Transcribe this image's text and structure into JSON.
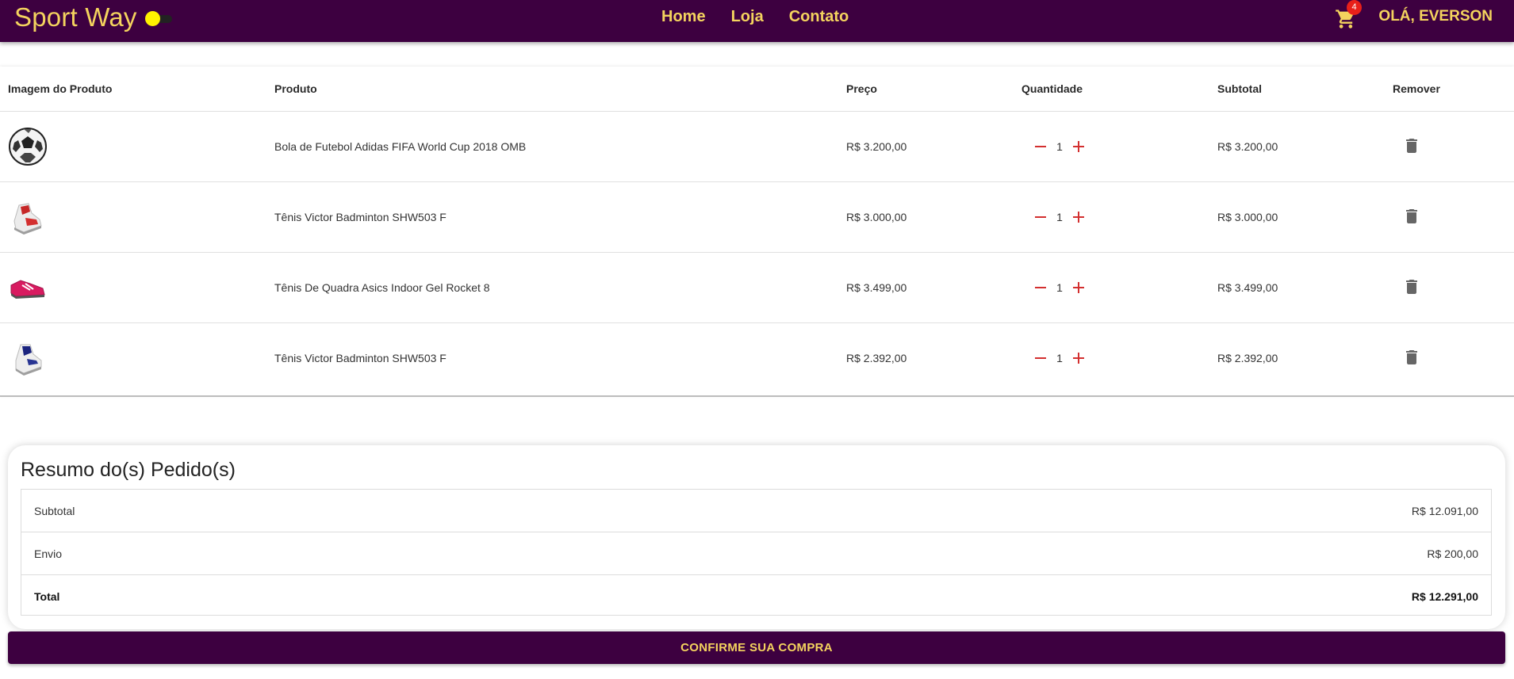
{
  "header": {
    "brand": "Sport Way",
    "nav": [
      "Home",
      "Loja",
      "Contato"
    ],
    "cart_count": "4",
    "greeting": "OLÁ, EVERSON",
    "colors": {
      "bar": "#3d0040",
      "accent": "#f4d35e"
    }
  },
  "table": {
    "columns": [
      "Imagem do Produto",
      "Produto",
      "Preço",
      "Quantidade",
      "Subtotal",
      "Remover"
    ],
    "rows": [
      {
        "image": "soccer-ball-image",
        "name": "Bola de Futebol Adidas FIFA World Cup 2018 OMB",
        "price": "R$ 3.200,00",
        "qty": "1",
        "subtotal": "R$ 3.200,00"
      },
      {
        "image": "badminton-shoe-red-white-image",
        "name": "Tênis Victor Badminton SHW503 F",
        "price": "R$ 3.000,00",
        "qty": "1",
        "subtotal": "R$ 3.000,00"
      },
      {
        "image": "asics-pink-shoe-image",
        "name": "Tênis De Quadra Asics Indoor Gel Rocket 8",
        "price": "R$ 3.499,00",
        "qty": "1",
        "subtotal": "R$ 3.499,00"
      },
      {
        "image": "badminton-shoe-navy-white-image",
        "name": "Tênis Victor Badminton SHW503 F",
        "price": "R$ 2.392,00",
        "qty": "1",
        "subtotal": "R$ 2.392,00"
      }
    ]
  },
  "summary": {
    "title": "Resumo do(s) Pedido(s)",
    "subtotal_label": "Subtotal",
    "subtotal_value": "R$ 12.091,00",
    "shipping_label": "Envio",
    "shipping_value": "R$ 200,00",
    "total_label": "Total",
    "total_value": "R$ 12.291,00"
  },
  "confirm_label": "CONFIRME SUA COMPRA"
}
